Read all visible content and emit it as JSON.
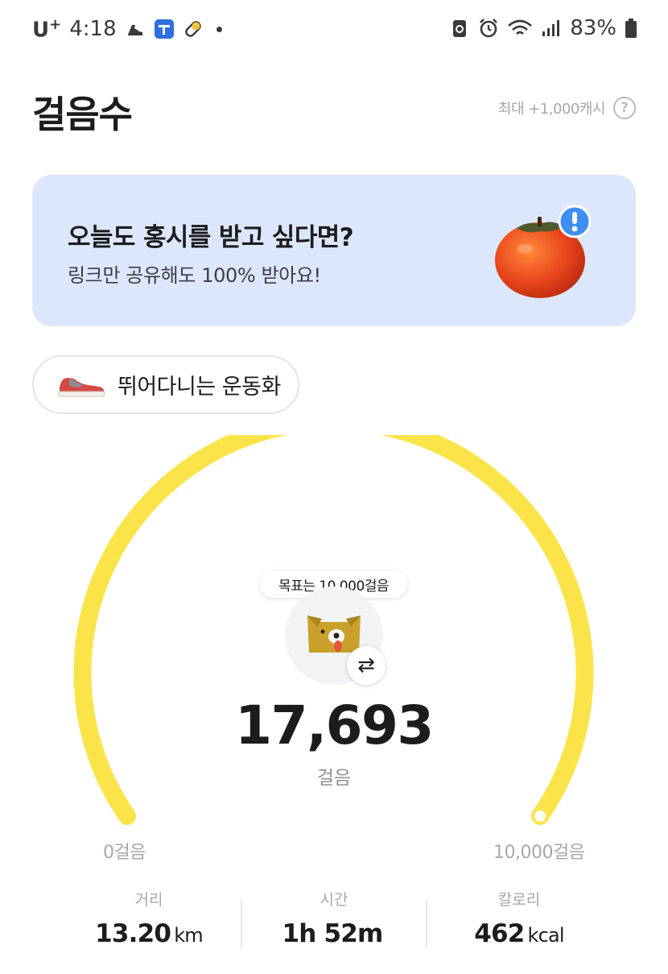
{
  "status_bar": {
    "carrier": "U",
    "carrier_sup": "+",
    "time": "4:18",
    "battery_pct": "83%"
  },
  "header": {
    "title": "걸음수",
    "max_cash": "최대 +1,000캐시",
    "help_label": "?"
  },
  "banner": {
    "title": "오늘도 홍시를 받고 싶다면?",
    "subtitle": "링크만 공유해도 100% 받아요!"
  },
  "shoe": {
    "label": "뛰어다니는 운동화"
  },
  "gauge": {
    "goal_bubble": "목표는 10,000걸음",
    "steps": "17,693",
    "unit": "걸음",
    "min_label": "0걸음",
    "max_label": "10,000걸음",
    "progress_fraction": 1.0,
    "color": "#fbe44a"
  },
  "stats": [
    {
      "label": "거리",
      "value": "13.20",
      "unit": "km"
    },
    {
      "label": "시간",
      "value": "1h 52m",
      "unit": ""
    },
    {
      "label": "칼로리",
      "value": "462",
      "unit": "kcal"
    }
  ],
  "icons": {
    "status_left": [
      "running-shoe-icon",
      "app-badge-icon",
      "pill-icon",
      "notification-dot-icon"
    ],
    "status_right": [
      "recycle-icon",
      "alarm-icon",
      "wifi-icon",
      "signal-icon",
      "battery-icon"
    ],
    "banner": "persimmon-icon",
    "chip": "sneaker-icon",
    "avatar": "dog-character-icon",
    "swap": "swap-arrows-icon"
  }
}
